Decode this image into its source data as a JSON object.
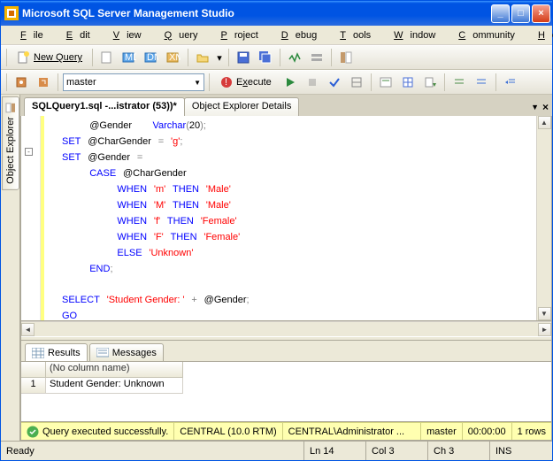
{
  "title": "Microsoft SQL Server Management Studio",
  "menu": {
    "file": "File",
    "edit": "Edit",
    "view": "View",
    "query": "Query",
    "project": "Project",
    "debug": "Debug",
    "tools": "Tools",
    "window": "Window",
    "community": "Community",
    "help": "Help"
  },
  "toolbar1": {
    "new_query": "New Query"
  },
  "toolbar2": {
    "db": "master",
    "execute": "Execute"
  },
  "side": {
    "object_explorer": "Object Explorer"
  },
  "tabs": {
    "active": "SQLQuery1.sql -...istrator (53))*",
    "other": "Object Explorer Details"
  },
  "code": {
    "l1": {
      "var": "@Gender",
      "type": "Varchar",
      "n": "20"
    },
    "l2": {
      "kw": "SET",
      "var": "@CharGender",
      "op": "=",
      "str": "'g'"
    },
    "l3": {
      "kw": "SET",
      "var": "@Gender",
      "op": "="
    },
    "l4": {
      "kw": "CASE",
      "var": "@CharGender"
    },
    "l5": {
      "kw1": "WHEN",
      "s1": "'m'",
      "kw2": "THEN",
      "s2": "'Male'"
    },
    "l6": {
      "kw1": "WHEN",
      "s1": "'M'",
      "kw2": "THEN",
      "s2": "'Male'"
    },
    "l7": {
      "kw1": "WHEN",
      "s1": "'f'",
      "kw2": "THEN",
      "s2": "'Female'"
    },
    "l8": {
      "kw1": "WHEN",
      "s1": "'F'",
      "kw2": "THEN",
      "s2": "'Female'"
    },
    "l9": {
      "kw": "ELSE",
      "s": "'Unknown'"
    },
    "l10": {
      "kw": "END"
    },
    "l12": {
      "kw": "SELECT",
      "s": "'Student Gender: '",
      "op": "+",
      "var": "@Gender"
    },
    "l13": {
      "kw": "GO"
    }
  },
  "results": {
    "tab_results": "Results",
    "tab_messages": "Messages",
    "col_header": "(No column name)",
    "row_num": "1",
    "cell": "Student Gender: Unknown"
  },
  "status_yellow": {
    "msg": "Query executed successfully.",
    "server": "CENTRAL (10.0 RTM)",
    "user": "CENTRAL\\Administrator ...",
    "db": "master",
    "time": "00:00:00",
    "rows": "1 rows"
  },
  "statusbar": {
    "ready": "Ready",
    "ln": "Ln 14",
    "col": "Col 3",
    "ch": "Ch 3",
    "ins": "INS"
  }
}
